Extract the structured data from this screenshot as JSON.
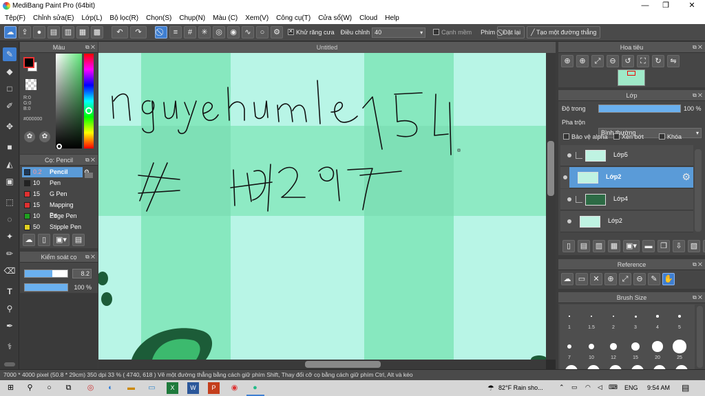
{
  "window": {
    "title": "MediBang Paint Pro (64bit)",
    "min": "—",
    "max": "❐",
    "close": "✕"
  },
  "menu": [
    "Tệp(F)",
    "Chỉnh sửa(E)",
    "Lớp(L)",
    "Bộ lọc(R)",
    "Chọn(S)",
    "Chụp(N)",
    "Màu (C)",
    "Xem(V)",
    "Công cụ(T)",
    "Cửa sổ(W)",
    "Cloud",
    "Help"
  ],
  "toolbar": {
    "antialias_label": "Khử răng cưa",
    "adjust_label": "Điều chỉnh",
    "adjust_value": "40",
    "edge_label": "Cạnh mềm",
    "key_label": "Phím",
    "reset_label": "Đặt lại",
    "straight_line_label": "Tạo một đường thẳng"
  },
  "color_panel": {
    "title": "Màu",
    "r": "R:0",
    "g": "G:0",
    "b": "B:0",
    "hex": "#000000",
    "fg": "#000000",
    "bg": "#ffffff"
  },
  "brush_panel": {
    "title": "Cọ: Pencil",
    "items": [
      {
        "size": "0.2",
        "name": "Pencil",
        "color": "#1f3a5a"
      },
      {
        "size": "10",
        "name": "Pen",
        "color": "#222222"
      },
      {
        "size": "15",
        "name": "G Pen",
        "color": "#e03030"
      },
      {
        "size": "15",
        "name": "Mapping Pe",
        "color": "#e03030"
      },
      {
        "size": "10",
        "name": "Edge Pen",
        "color": "#20a020"
      },
      {
        "size": "50",
        "name": "Stipple Pen",
        "color": "#e0d020"
      }
    ]
  },
  "brush_control": {
    "title": "Kiểm soát cọ",
    "size_value": "8.2",
    "size_fraction": 0.65,
    "opacity_value": "100 %",
    "opacity_fraction": 1.0
  },
  "canvas": {
    "tab_title": "Untitled"
  },
  "navigator": {
    "title": "Hoa tiêu"
  },
  "layer_panel": {
    "title": "Lớp",
    "opacity_label": "Độ trong",
    "opacity_value": "100 %",
    "opacity_fraction": 1.0,
    "blend_label": "Pha trộn",
    "blend_value": "Bình thường",
    "protect_alpha": "Bảo vệ alpha",
    "clipping": "Xén bớt",
    "lock": "Khóa",
    "layers": [
      {
        "name": "Lớp5",
        "selected": false
      },
      {
        "name": "Lớp2",
        "selected": true
      },
      {
        "name": "Lớp4",
        "selected": false
      },
      {
        "name": "Lớp2",
        "selected": false
      }
    ]
  },
  "reference_panel": {
    "title": "Reference"
  },
  "brush_size_panel": {
    "title": "Brush Size",
    "sizes": [
      {
        "label": "1",
        "dot": 1
      },
      {
        "label": "1.5",
        "dot": 1.5
      },
      {
        "label": "2",
        "dot": 2
      },
      {
        "label": "3",
        "dot": 2.5
      },
      {
        "label": "4",
        "dot": 3
      },
      {
        "label": "5",
        "dot": 3.5
      },
      {
        "label": "7",
        "dot": 5
      },
      {
        "label": "10",
        "dot": 7
      },
      {
        "label": "12",
        "dot": 8
      },
      {
        "label": "15",
        "dot": 10
      },
      {
        "label": "20",
        "dot": 13
      },
      {
        "label": "25",
        "dot": 16
      }
    ]
  },
  "status": {
    "text": "7000 * 4000 pixel   (50.8 * 29cm)   350 dpi   33 %   ( 4740, 618 )   Vẽ một đường thẳng bằng cách giữ phím Shift, Thay đổi cỡ cọ bằng cách giữ phím Ctrl, Alt và kéo"
  },
  "taskbar": {
    "weather": "82°F  Rain sho...",
    "lang": "ENG",
    "time": "9:54 AM"
  }
}
